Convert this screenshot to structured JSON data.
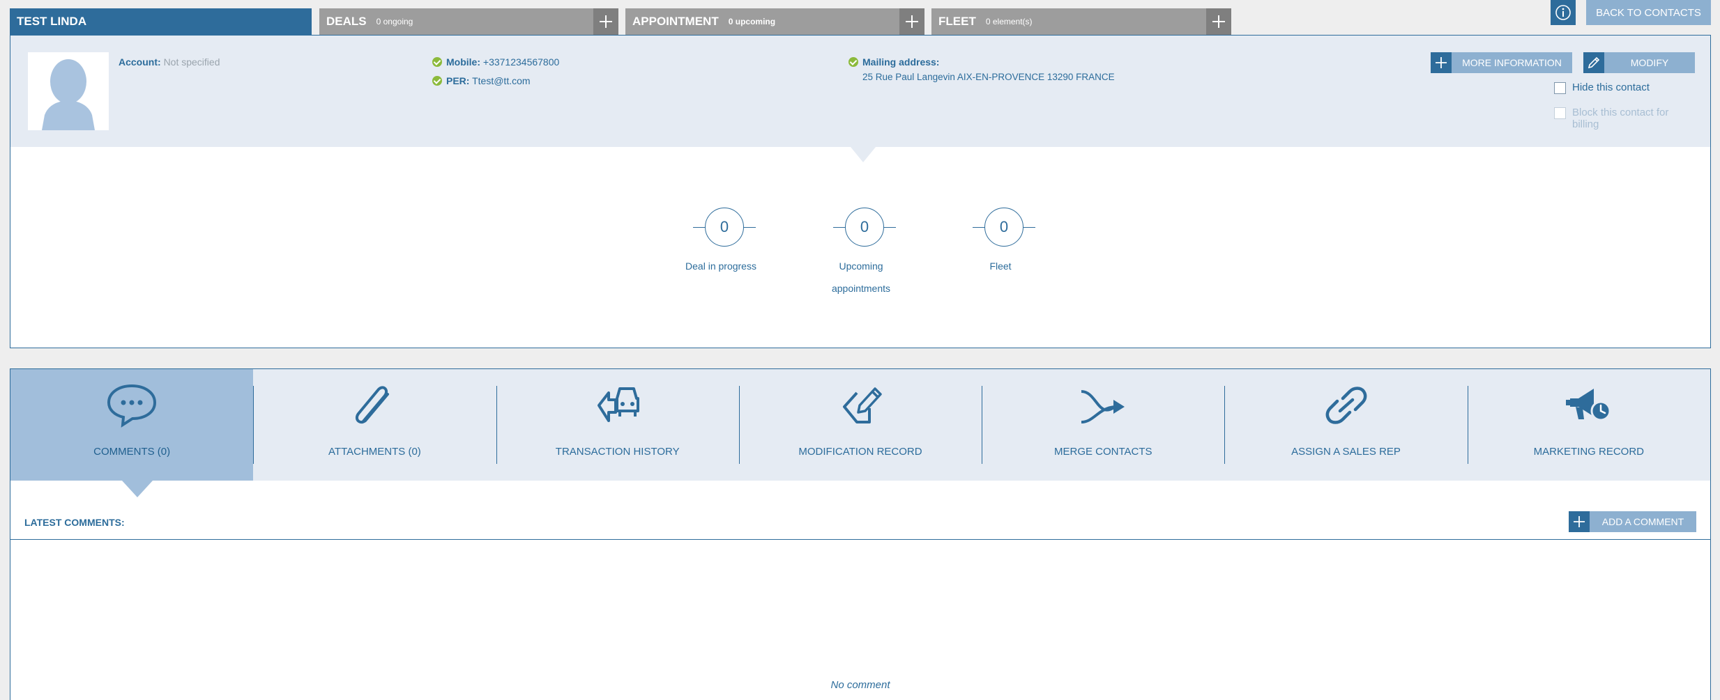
{
  "tabs": {
    "contact_name": "TEST LINDA",
    "deals": {
      "title": "DEALS",
      "sub": "0 ongoing"
    },
    "appointment": {
      "title": "APPOINTMENT",
      "sub": "0 upcoming"
    },
    "fleet": {
      "title": "FLEET",
      "sub": "0 element(s)"
    }
  },
  "header": {
    "info_icon": "info-icon",
    "back_label": "BACK TO CONTACTS"
  },
  "contact": {
    "account_label": "Account:",
    "account_value": "Not specified",
    "mobile_label": "Mobile:",
    "mobile_value": "+3371234567800",
    "per_label": "PER:",
    "per_value": "Ttest@tt.com",
    "mailing_label": "Mailing address:",
    "mailing_value": "25 Rue Paul Langevin AIX-EN-PROVENCE 13290 FRANCE",
    "more_info_label": "MORE INFORMATION",
    "modify_label": "MODIFY",
    "hide_label": "Hide this contact",
    "block_label_1": "Block this contact for",
    "block_label_2": "billing"
  },
  "stats": [
    {
      "value": "0",
      "label": "Deal in progress",
      "label2": ""
    },
    {
      "value": "0",
      "label": "Upcoming",
      "label2": "appointments"
    },
    {
      "value": "0",
      "label": "Fleet",
      "label2": ""
    }
  ],
  "tools": [
    {
      "label": "COMMENTS (0)",
      "icon": "speech-bubble-icon"
    },
    {
      "label": "ATTACHMENTS (0)",
      "icon": "paperclip-icon"
    },
    {
      "label": "TRANSACTION HISTORY",
      "icon": "car-history-icon"
    },
    {
      "label": "MODIFICATION RECORD",
      "icon": "edit-record-icon"
    },
    {
      "label": "MERGE CONTACTS",
      "icon": "merge-arrow-icon"
    },
    {
      "label": "ASSIGN A SALES REP",
      "icon": "link-icon"
    },
    {
      "label": "MARKETING RECORD",
      "icon": "megaphone-clock-icon"
    }
  ],
  "comments": {
    "latest_label": "LATEST COMMENTS:",
    "add_label": "ADD A COMMENT",
    "empty_label": "No comment"
  },
  "colors": {
    "primary": "#2e6c9b",
    "light_blue": "#8db0d0",
    "panel_bg": "#e5ebf3",
    "active_tool": "#a1bedb",
    "tab_grey": "#9d9d9d",
    "check_green": "#8cba3b"
  }
}
